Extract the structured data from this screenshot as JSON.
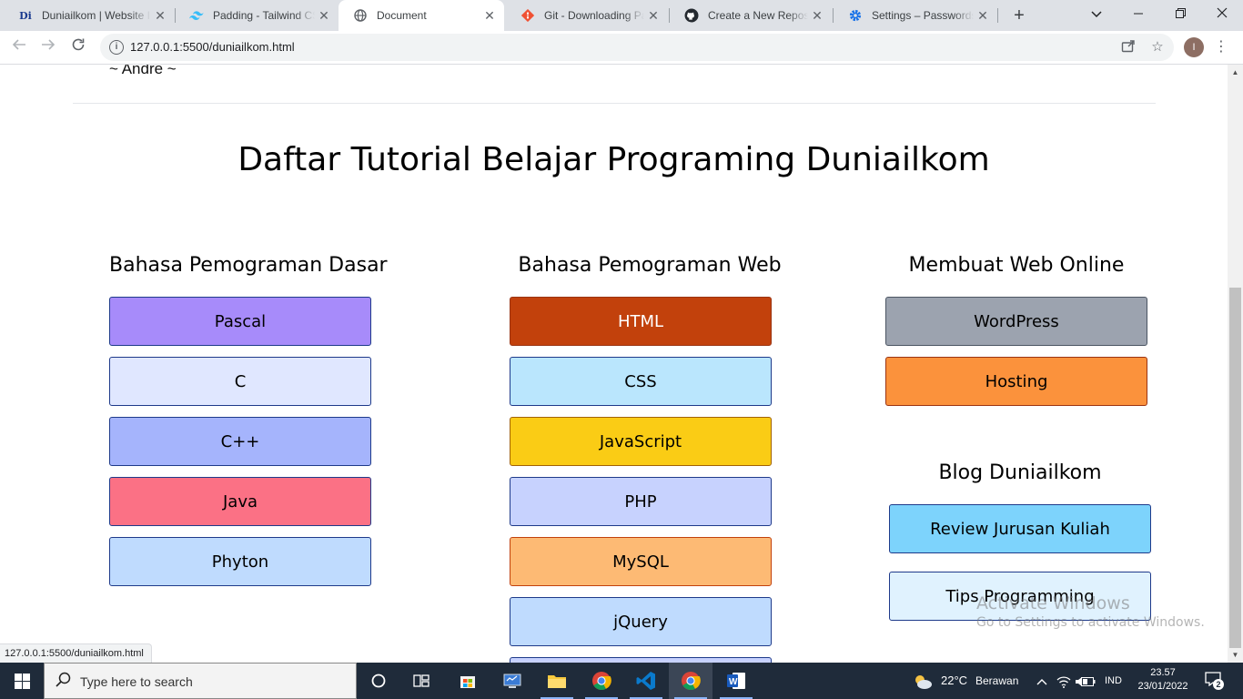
{
  "browser": {
    "tabs": [
      {
        "title": "Duniailkom | Website I",
        "favicon": "duniailkom-icon",
        "favicon_text": "Di"
      },
      {
        "title": "Padding - Tailwind CSS",
        "favicon": "tailwind-icon"
      },
      {
        "title": "Document",
        "favicon": "globe-icon"
      },
      {
        "title": "Git - Downloading Pac",
        "favicon": "git-icon"
      },
      {
        "title": "Create a New Reposito",
        "favicon": "github-icon"
      },
      {
        "title": "Settings – Passwords",
        "favicon": "settings-gear-icon"
      }
    ],
    "active_tab": 2,
    "url": "127.0.0.1:5500/duniailkom.html",
    "profile_initial": "I",
    "status_url": "127.0.0.1:5500/duniailkom.html"
  },
  "page": {
    "author": "~ Andre ~",
    "title": "Daftar Tutorial Belajar Programing Duniailkom",
    "columns": [
      {
        "heading": "Bahasa Pemograman Dasar",
        "items": [
          {
            "label": "Pascal",
            "color": "#a78bfa"
          },
          {
            "label": "C",
            "color": "#e0e7ff"
          },
          {
            "label": "C++",
            "color": "#a5b4fc"
          },
          {
            "label": "Java",
            "color": "#fb7185"
          },
          {
            "label": "Phyton",
            "color": "#bfdbfe"
          }
        ]
      },
      {
        "heading": "Bahasa Pemograman Web",
        "items": [
          {
            "label": "HTML",
            "color": "#c2410c",
            "text_color": "#ffffff"
          },
          {
            "label": "CSS",
            "color": "#bae6fd"
          },
          {
            "label": "JavaScript",
            "color": "#facc15"
          },
          {
            "label": "PHP",
            "color": "#c7d2fe"
          },
          {
            "label": "MySQL",
            "color": "#fdba74"
          },
          {
            "label": "jQuery",
            "color": "#bfdbfe"
          }
        ]
      },
      {
        "heading": "Membuat Web Online",
        "items": [
          {
            "label": "WordPress",
            "color": "#9ca3af"
          },
          {
            "label": "Hosting",
            "color": "#fb923c"
          }
        ]
      },
      {
        "heading": "Blog Duniailkom",
        "items": [
          {
            "label": "Review Jurusan Kuliah",
            "color": "#7dd3fc"
          },
          {
            "label": "Tips Programming",
            "color": "#e0f2fe"
          }
        ]
      }
    ],
    "watermark_line1": "Activate Windows",
    "watermark_line2": "Go to Settings to activate Windows."
  },
  "taskbar": {
    "search_placeholder": "Type here to search",
    "weather_temp": "22°C",
    "weather_text": "Berawan",
    "language": "IND",
    "time": "23.57",
    "date": "23/01/2022",
    "notification_count": "2"
  }
}
